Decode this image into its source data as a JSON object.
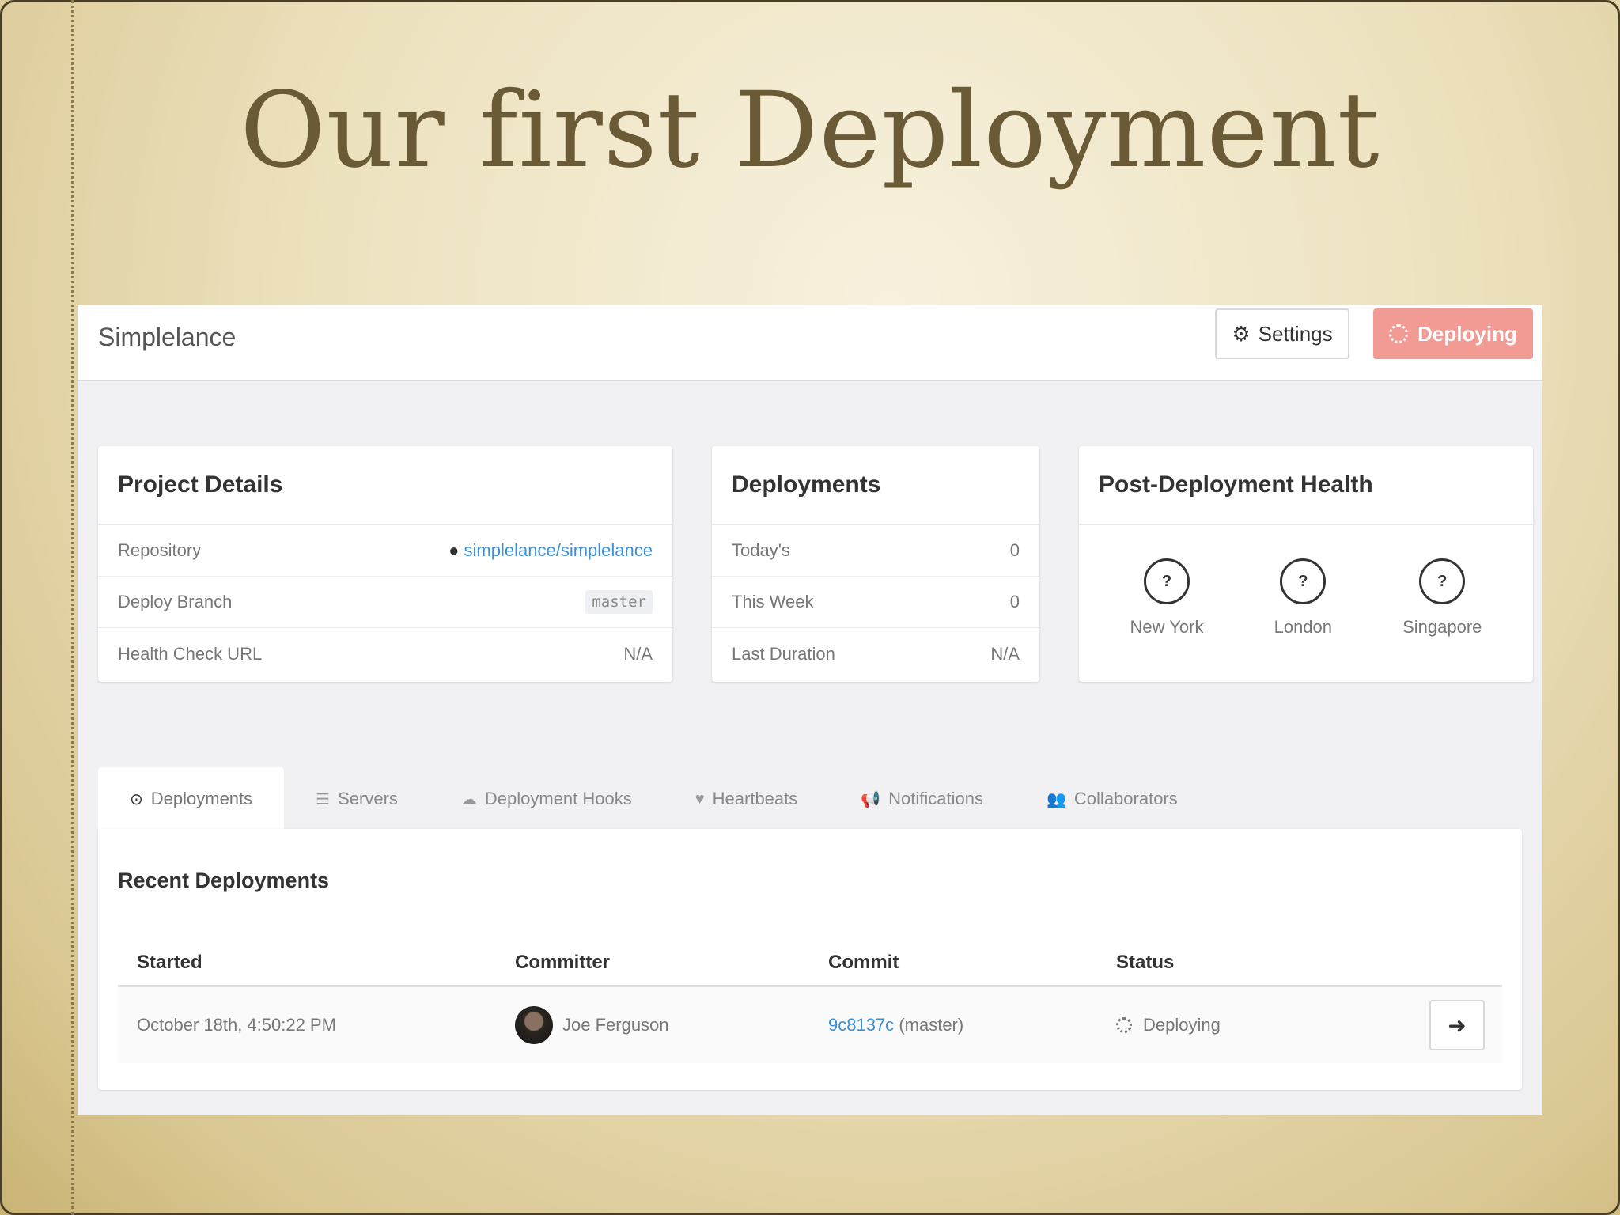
{
  "slide": {
    "title": "Our first Deployment"
  },
  "header": {
    "app_name": "Simplelance",
    "settings_label": "Settings",
    "deploying_label": "Deploying"
  },
  "project_details": {
    "title": "Project Details",
    "rows": [
      {
        "label": "Repository",
        "value": "simplelance/simplelance"
      },
      {
        "label": "Deploy Branch",
        "value": "master"
      },
      {
        "label": "Health Check URL",
        "value": "N/A"
      }
    ]
  },
  "deployments_card": {
    "title": "Deployments",
    "rows": [
      {
        "label": "Today's",
        "value": "0"
      },
      {
        "label": "This Week",
        "value": "0"
      },
      {
        "label": "Last Duration",
        "value": "N/A"
      }
    ]
  },
  "health": {
    "title": "Post-Deployment Health",
    "icon_text": "?",
    "locations": [
      "New York",
      "London",
      "Singapore"
    ]
  },
  "tabs": [
    {
      "label": "Deployments",
      "icon": "clock-icon",
      "glyph": "⊙"
    },
    {
      "label": "Servers",
      "icon": "server-icon",
      "glyph": "☰"
    },
    {
      "label": "Deployment Hooks",
      "icon": "cloud-icon",
      "glyph": "☁"
    },
    {
      "label": "Heartbeats",
      "icon": "heart-icon",
      "glyph": "♥"
    },
    {
      "label": "Notifications",
      "icon": "bullhorn-icon",
      "glyph": "📢"
    },
    {
      "label": "Collaborators",
      "icon": "users-icon",
      "glyph": "👥"
    }
  ],
  "recent": {
    "title": "Recent Deployments",
    "columns": [
      "Started",
      "Committer",
      "Commit",
      "Status"
    ],
    "rows": [
      {
        "started": "October 18th, 4:50:22 PM",
        "committer": "Joe Ferguson",
        "commit_hash": "9c8137c",
        "commit_branch": "(master)",
        "status": "Deploying"
      }
    ]
  },
  "colors": {
    "accent_link": "#3a8fd6",
    "deploying_button": "#f29a94",
    "slide_title": "#6a5a36"
  }
}
